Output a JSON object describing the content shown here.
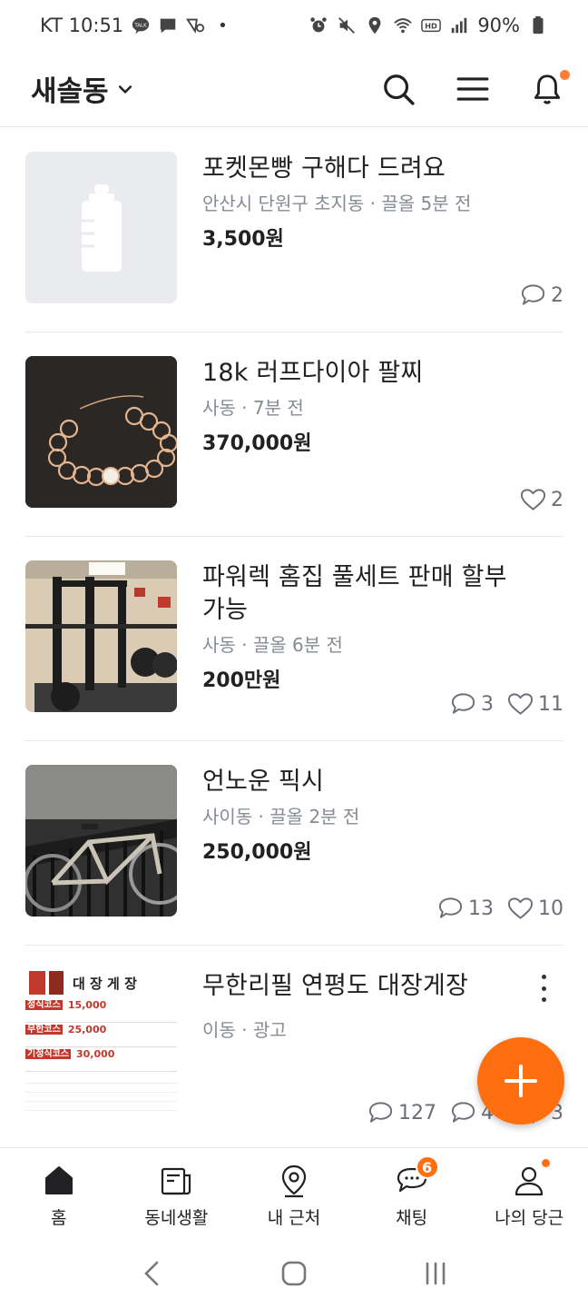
{
  "status_bar": {
    "carrier_time": "KT 10:51",
    "dot": "•",
    "battery": "90%",
    "icons": [
      "talk-icon",
      "message-icon",
      "vibrate-alarm-icon",
      "alarm-icon",
      "mute-icon",
      "location-icon",
      "wifi-icon",
      "hd-icon",
      "signal-icon",
      "battery-icon"
    ]
  },
  "header": {
    "location": "새솔동",
    "icons": [
      "chevron-down-icon",
      "search-icon",
      "menu-icon",
      "bell-icon"
    ],
    "accent": "#ff7e36"
  },
  "items": [
    {
      "title": "포켓몬빵 구해다 드려요",
      "meta": "안산시 단원구 초지동 · 끌올 5분 전",
      "price": "3,500원",
      "chat_count": "2",
      "thumb": "placeholder-bottle-icon"
    },
    {
      "title": "18k 러프다이아 팔찌",
      "meta": "사동 · 7분 전",
      "price": "370,000원",
      "like_count": "2",
      "thumb": "bracelet-photo"
    },
    {
      "title": "파워렉 홈집 풀세트 판매 할부 가능",
      "meta": "사동 · 끌올 6분 전",
      "price": "200만원",
      "chat_count": "3",
      "like_count": "11",
      "thumb": "home-gym-photo"
    },
    {
      "title": "언노운 픽시",
      "meta": "사이동 · 끌올 2분 전",
      "price": "250,000원",
      "chat_count": "13",
      "like_count": "10",
      "thumb": "bicycle-photo"
    },
    {
      "title": "무한리필 연평도 대장게장",
      "meta": "이동 · 광고",
      "comment_count": "127",
      "chat_count": "44",
      "like_count": "3",
      "thumb": "ad-menu-photo",
      "ad_thumb_text": {
        "heading": "대 장 게 장",
        "line1": "정식코스",
        "line1_price": "15,000",
        "line2": "무한코스",
        "line2_price": "25,000",
        "line3": "기정식코스",
        "line3_price": "30,000"
      }
    }
  ],
  "fab": {
    "icon": "plus-icon",
    "color": "#ff6f0f"
  },
  "bottom_nav": [
    {
      "label": "홈",
      "icon": "home-icon",
      "active": true
    },
    {
      "label": "동네생활",
      "icon": "news-icon"
    },
    {
      "label": "내 근처",
      "icon": "location-pin-icon"
    },
    {
      "label": "채팅",
      "icon": "chat-icon",
      "badge": "6"
    },
    {
      "label": "나의 당근",
      "icon": "person-icon",
      "dot": true
    }
  ],
  "system_nav": [
    "back-icon",
    "home-circle-icon",
    "recents-icon"
  ]
}
